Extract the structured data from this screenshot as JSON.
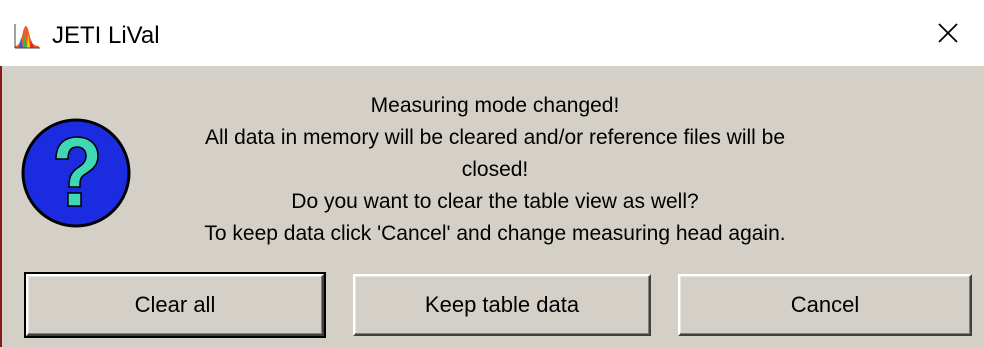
{
  "window": {
    "title": "JETI LiVal",
    "app_icon": "spectrum-chart-icon",
    "close_icon": "close-icon"
  },
  "dialog": {
    "icon": "question-icon",
    "message_lines": [
      "Measuring mode changed!",
      "All data in memory will be cleared and/or reference files will be",
      "closed!",
      "Do you want to clear the table view as well?",
      "To keep data click 'Cancel' and change measuring head again."
    ]
  },
  "buttons": {
    "clear_all": "Clear all",
    "keep_table_data": "Keep table data",
    "cancel": "Cancel"
  },
  "colors": {
    "dialog_background": "#d4d0c8",
    "question_icon_fill": "#1a2be0",
    "question_mark": "#3fd7b5"
  }
}
